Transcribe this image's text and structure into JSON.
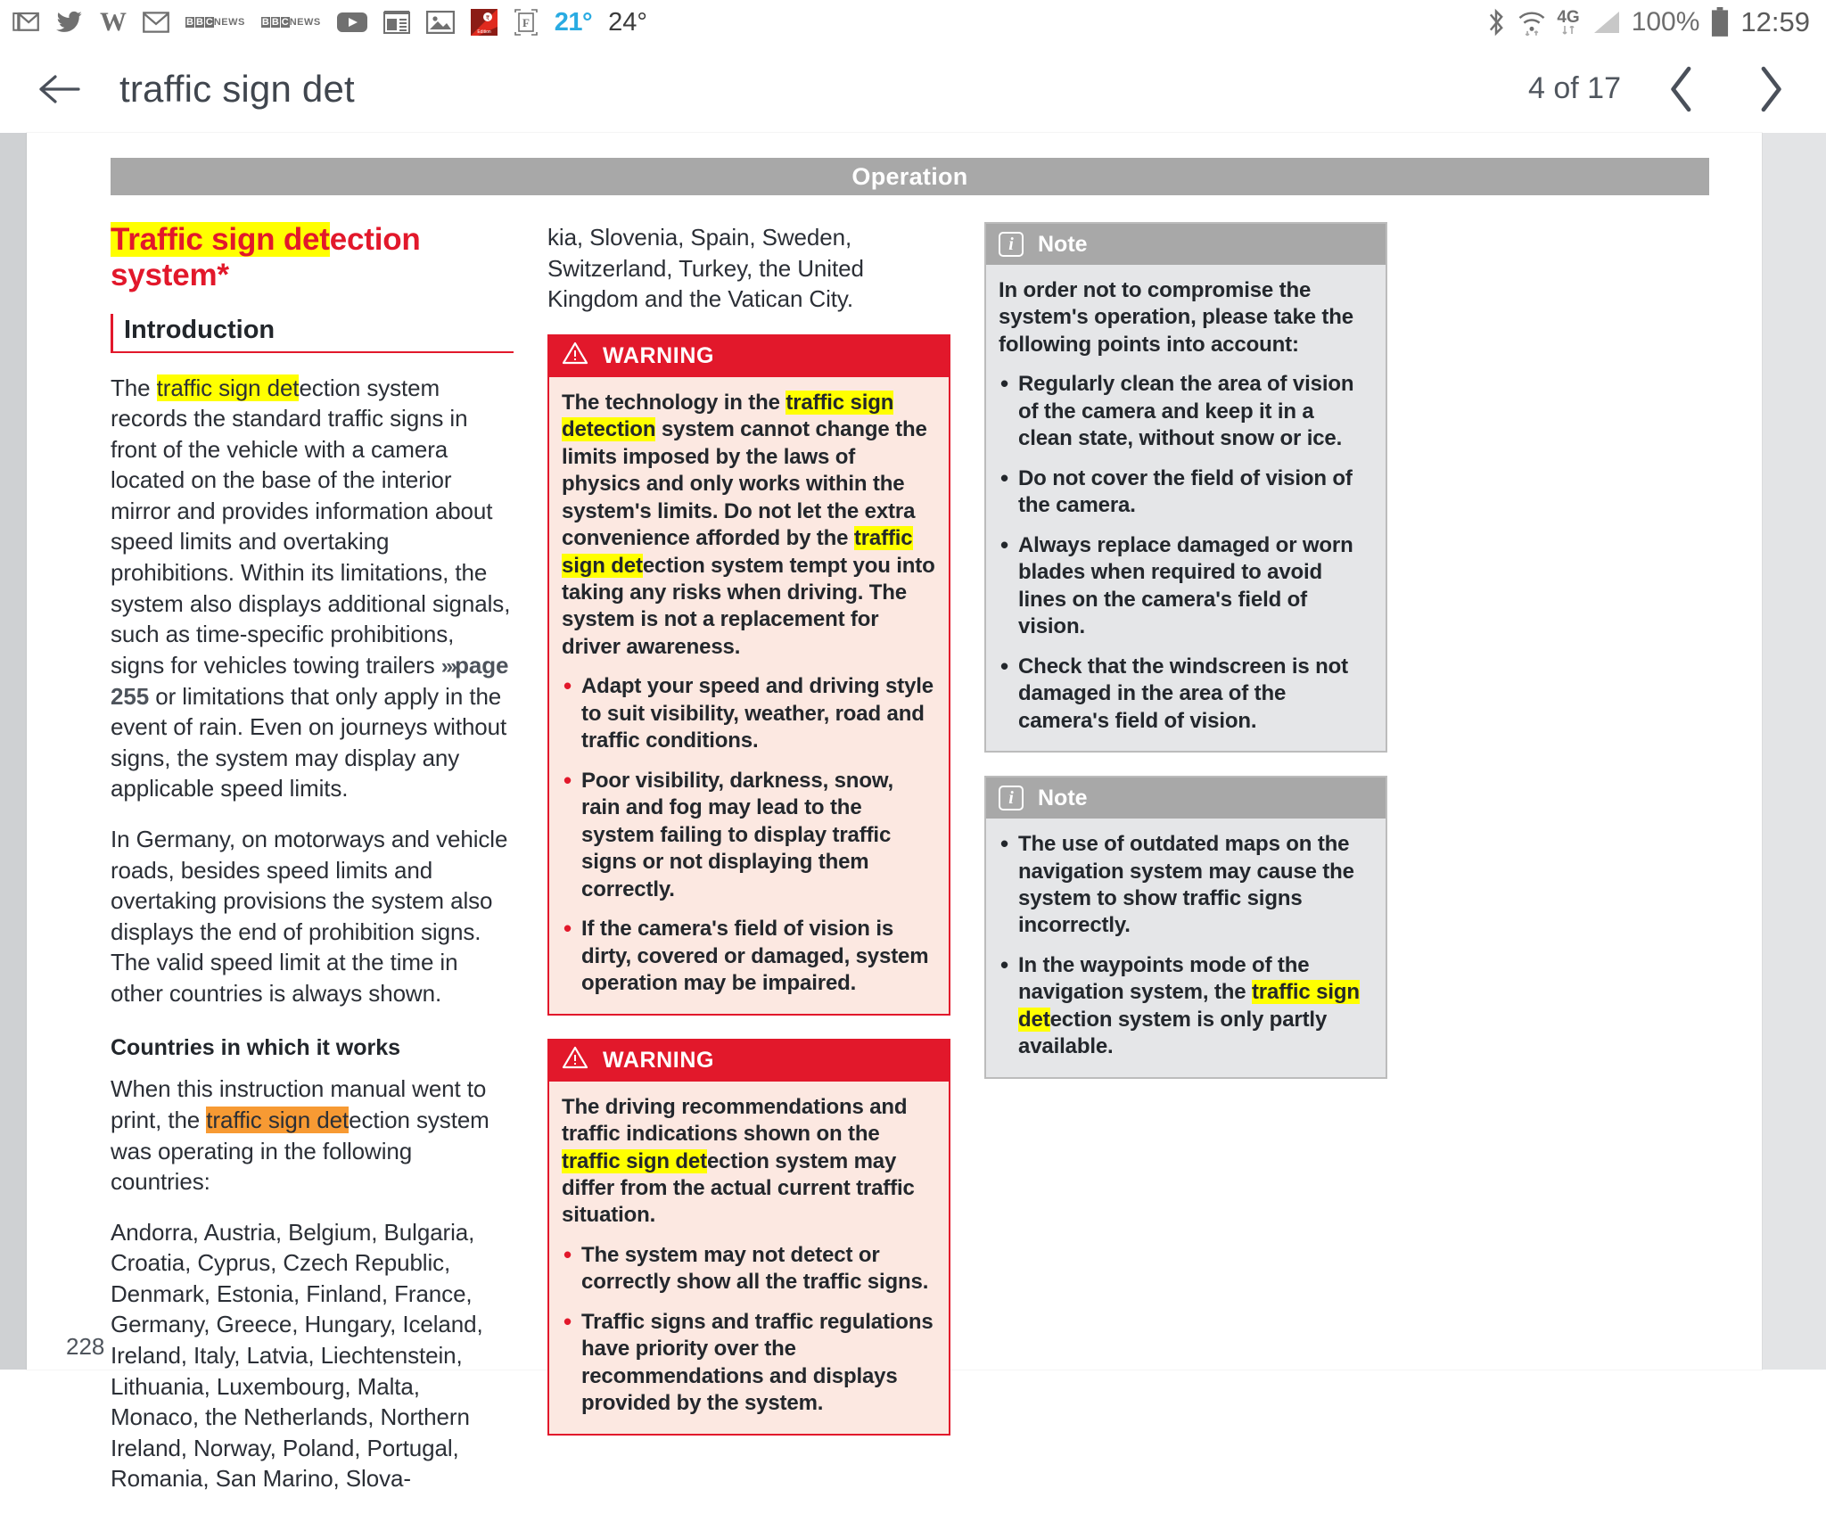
{
  "status_bar": {
    "left_icons": [
      {
        "name": "gmail-stack-icon",
        "glyph": "M"
      },
      {
        "name": "twitter-icon",
        "glyph": "t"
      },
      {
        "name": "wikipedia-icon",
        "glyph": "W"
      },
      {
        "name": "gmail-icon",
        "glyph": "M"
      },
      {
        "name": "bbc-news-icon",
        "glyph": "NEWS"
      },
      {
        "name": "bbc-news-icon-2",
        "glyph": "NEWS"
      },
      {
        "name": "youtube-icon",
        "glyph": "▶"
      },
      {
        "name": "news-reader-icon",
        "glyph": "☷"
      },
      {
        "name": "gallery-icon",
        "glyph": "Ὓc"
      },
      {
        "name": "edition-app-icon",
        "glyph": "Edition"
      },
      {
        "name": "flipboard-icon",
        "glyph": "F"
      }
    ],
    "temperature_primary": "21°",
    "temperature_secondary": "24°",
    "bluetooth": "bluetooth-icon",
    "wifi": "wifi-icon",
    "network": "4G",
    "signal": "signal-icon",
    "battery_percent": "100%",
    "battery": "battery-full-icon",
    "clock": "12:59"
  },
  "app_bar": {
    "back": "back-arrow-icon",
    "title": "traffic sign det",
    "page_counter": "4 of 17",
    "prev": "chevron-left-icon",
    "next": "chevron-right-icon"
  },
  "document": {
    "section_band": "Operation",
    "folio": "228",
    "left_column": {
      "title_highlight": "Traffic sign det",
      "title_rest": "ection system*",
      "subhead": "Introduction",
      "para1_a": "The ",
      "para1_hl": "traffic sign det",
      "para1_b": "ection system records the standard traffic signs in front of the vehicle with a camera located on the base of the interior mirror and provides information about speed limits and overtaking prohibitions. Within its limitations, the system also displays additional signals, such as time-specific prohibitions, signs for vehicles towing trailers ",
      "xref_arrows": "»›",
      "xref_label": "page 255",
      "para1_c": " or limitations that only apply in the event of rain. Even on journeys without signs, the system may display any applicable speed limits.",
      "para2": "In Germany, on motorways and vehicle roads, besides speed limits and overtaking provisions the system also displays the end of prohibition signs. The valid speed limit at the time in other countries is always shown.",
      "minor_head": "Countries in which it works",
      "para3_a": "When this instruction manual went to print, the ",
      "para3_hl": "traffic sign det",
      "para3_b": "ection system was operating in the following countries:",
      "para4": "Andorra, Austria, Belgium, Bulgaria, Croatia, Cyprus, Czech Republic, Denmark, Estonia, Finland, France, Germany, Greece, Hungary, Iceland, Ireland, Italy, Latvia, Liechtenstein, Lithuania, Luxembourg, Malta, Monaco, the Netherlands, Northern Ireland, Norway, Poland, Portugal, Romania, San Marino, Slova-"
    },
    "middle_column": {
      "countries_continued": "kia, Slovenia, Spain, Sweden, Switzerland, Turkey, the United Kingdom and the Vatican City.",
      "warning1": {
        "icon": "warning-triangle-icon",
        "label": "WARNING",
        "p1_a": "The technology in the ",
        "p1_hl1": "traffic sign detection",
        "p1_b": " system cannot change the limits imposed by the laws of physics and only works within the system's limits. Do not let the extra convenience afforded by the ",
        "p1_hl2": "traffic sign det",
        "p1_c": "ection system tempt you into taking any risks when driving. The system is not a replacement for driver awareness.",
        "b1": "Adapt your speed and driving style to suit visibility, weather, road and traffic conditions.",
        "b2": "Poor visibility, darkness, snow, rain and fog may lead to the system failing to display traffic signs or not displaying them correctly.",
        "b3": "If the camera's field of vision is dirty, covered or damaged, system operation may be impaired."
      },
      "warning2": {
        "icon": "warning-triangle-icon",
        "label": "WARNING",
        "p1_a": "The driving recommendations and traffic indications shown on the ",
        "p1_hl": "traffic sign det",
        "p1_b": "ection system may differ from the actual current traffic situation.",
        "b1": "The system may not detect or correctly show all the traffic signs.",
        "b2": "Traffic signs and traffic regulations have priority over the recommendations and displays provided by the system."
      }
    },
    "right_column": {
      "note1": {
        "icon": "info-icon",
        "icon_glyph": "i",
        "label": "Note",
        "intro": "In order not to compromise the system's operation, please take the following points into account:",
        "b1": "Regularly clean the area of vision of the camera and keep it in a clean state, without snow or ice.",
        "b2": "Do not cover the field of vision of the camera.",
        "b3": "Always replace damaged or worn blades when required to avoid lines on the camera's field of vision.",
        "b4": "Check that the windscreen is not damaged in the area of the camera's field of vision."
      },
      "note2": {
        "icon": "info-icon",
        "icon_glyph": "i",
        "label": "Note",
        "b1": "The use of outdated maps on the navigation system may cause the system to show traffic signs incorrectly.",
        "b2_a": "In the waypoints mode of the navigation system, the ",
        "b2_hl": "traffic sign det",
        "b2_b": "ection system is only partly available."
      }
    }
  },
  "colors": {
    "brand_red": "#e2182b",
    "highlight_yellow": "#ffff00",
    "highlight_orange": "#f79a33",
    "warning_bg": "#fce8e1",
    "note_bg": "#e5e6e8",
    "note_header": "#a8a8a8",
    "accent_blue": "#29ABE2"
  }
}
